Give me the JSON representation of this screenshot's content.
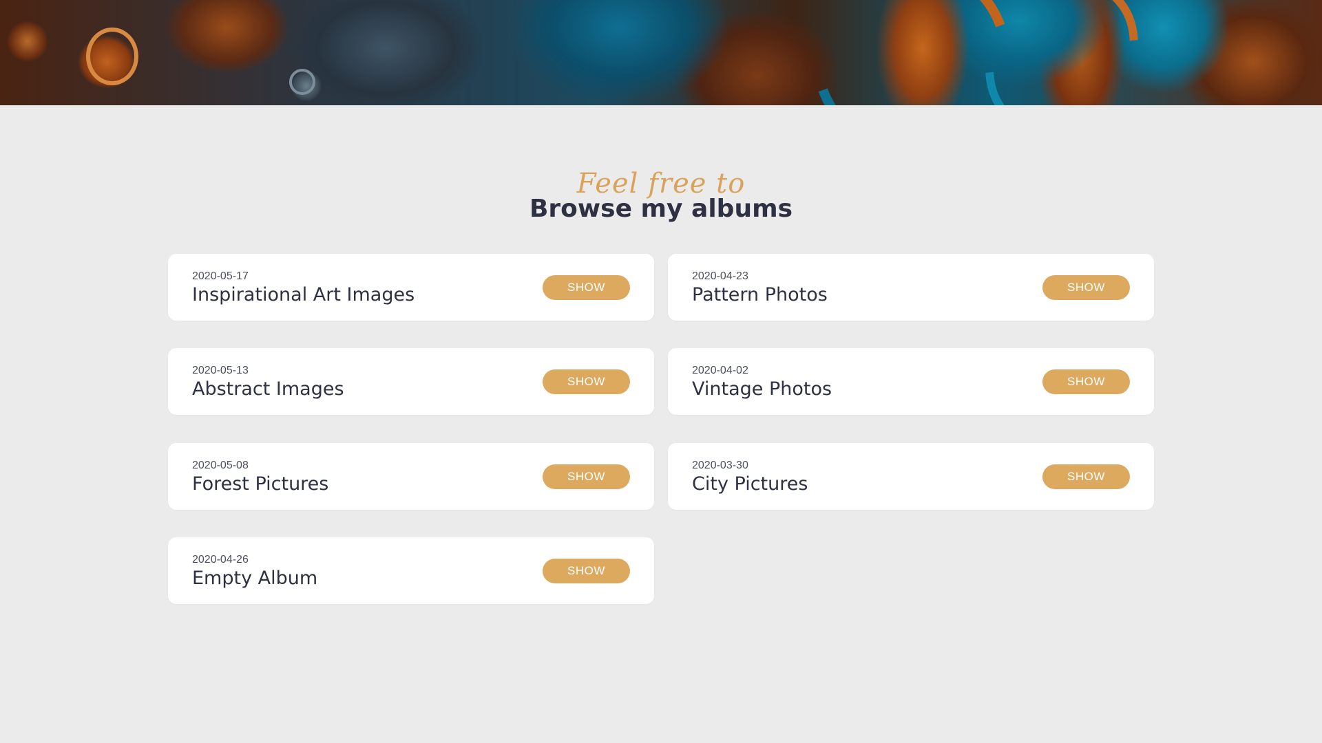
{
  "header": {
    "script_heading": "Feel free to",
    "main_heading": "Browse my albums"
  },
  "albums": [
    {
      "date": "2020-05-17",
      "title": "Inspirational Art Images",
      "button": "SHOW"
    },
    {
      "date": "2020-04-23",
      "title": "Pattern Photos",
      "button": "SHOW"
    },
    {
      "date": "2020-05-13",
      "title": "Abstract Images",
      "button": "SHOW"
    },
    {
      "date": "2020-04-02",
      "title": "Vintage Photos",
      "button": "SHOW"
    },
    {
      "date": "2020-05-08",
      "title": "Forest Pictures",
      "button": "SHOW"
    },
    {
      "date": "2020-03-30",
      "title": "City Pictures",
      "button": "SHOW"
    },
    {
      "date": "2020-04-26",
      "title": "Empty Album",
      "button": "SHOW"
    }
  ],
  "colors": {
    "background": "#ebebeb",
    "card": "#ffffff",
    "accent": "#dca95f",
    "text_dark": "#2d3142"
  }
}
